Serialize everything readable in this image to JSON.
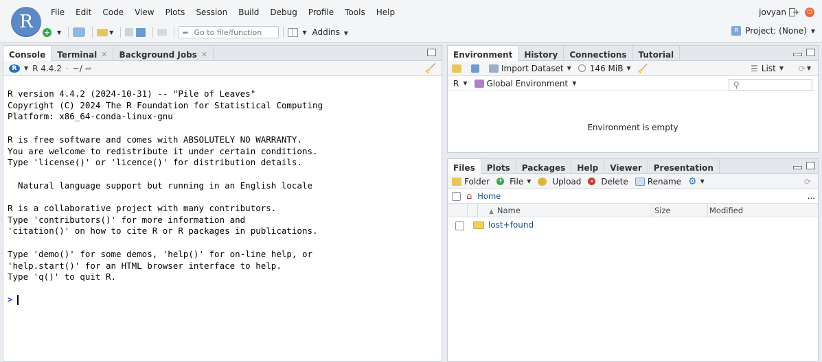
{
  "menubar": [
    "File",
    "Edit",
    "Code",
    "View",
    "Plots",
    "Session",
    "Build",
    "Debug",
    "Profile",
    "Tools",
    "Help"
  ],
  "user": "jovyan",
  "logo_letter": "R",
  "toolbar": {
    "goto_placeholder": "Go to file/function",
    "addins_label": "Addins"
  },
  "project_label": "Project: (None)",
  "console_pane": {
    "tabs": [
      {
        "label": "Console",
        "closable": false
      },
      {
        "label": "Terminal",
        "closable": true
      },
      {
        "label": "Background Jobs",
        "closable": true
      }
    ],
    "r_version": "R 4.4.2",
    "path": "~/",
    "output_lines": [
      "R version 4.4.2 (2024-10-31) -- \"Pile of Leaves\"",
      "Copyright (C) 2024 The R Foundation for Statistical Computing",
      "Platform: x86_64-conda-linux-gnu",
      "",
      "R is free software and comes with ABSOLUTELY NO WARRANTY.",
      "You are welcome to redistribute it under certain conditions.",
      "Type 'license()' or 'licence()' for distribution details.",
      "",
      "  Natural language support but running in an English locale",
      "",
      "R is a collaborative project with many contributors.",
      "Type 'contributors()' for more information and",
      "'citation()' on how to cite R or R packages in publications.",
      "",
      "Type 'demo()' for some demos, 'help()' for on-line help, or",
      "'help.start()' for an HTML browser interface to help.",
      "Type 'q()' to quit R."
    ],
    "prompt": ">"
  },
  "env_pane": {
    "tabs": [
      "Environment",
      "History",
      "Connections",
      "Tutorial"
    ],
    "import_label": "Import Dataset",
    "memory": "146 MiB",
    "list_label": "List",
    "lang": "R",
    "scope": "Global Environment",
    "empty_text": "Environment is empty"
  },
  "files_pane": {
    "tabs": [
      "Files",
      "Plots",
      "Packages",
      "Help",
      "Viewer",
      "Presentation"
    ],
    "actions": [
      "Folder",
      "File",
      "Upload",
      "Delete",
      "Rename"
    ],
    "breadcrumb": "Home",
    "more": "...",
    "columns": [
      "Name",
      "Size",
      "Modified"
    ],
    "rows": [
      {
        "name": "lost+found",
        "size": "",
        "modified": ""
      }
    ]
  },
  "colors": {
    "accent": "#5b8ac6",
    "link": "#1a4b8f",
    "folder": "#f2cf62"
  }
}
